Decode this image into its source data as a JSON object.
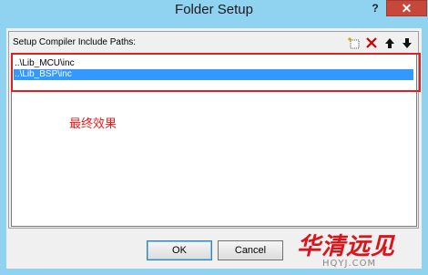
{
  "window": {
    "title": "Folder Setup",
    "help_glyph": "?",
    "close_glyph": "✕"
  },
  "group": {
    "label": "Setup Compiler Include Paths:"
  },
  "toolbar": {
    "buttons": [
      {
        "icon": "new-folder-icon"
      },
      {
        "icon": "delete-icon",
        "color": "#cc0000"
      },
      {
        "icon": "move-up-icon"
      },
      {
        "icon": "move-down-icon"
      }
    ]
  },
  "paths": [
    {
      "value": "..\\Lib_MCU\\inc",
      "selected": false
    },
    {
      "value": "..\\Lib_BSP\\inc",
      "selected": true
    }
  ],
  "annotation": "最终效果",
  "buttons": {
    "ok": "OK",
    "cancel": "Cancel"
  },
  "watermark": {
    "text": "华清远见",
    "sub": "HQYJ.COM"
  },
  "colors": {
    "titlebar": "#8fd3f0",
    "close": "#c7473a",
    "selection": "#3399ff",
    "highlight_border": "#e02020"
  }
}
